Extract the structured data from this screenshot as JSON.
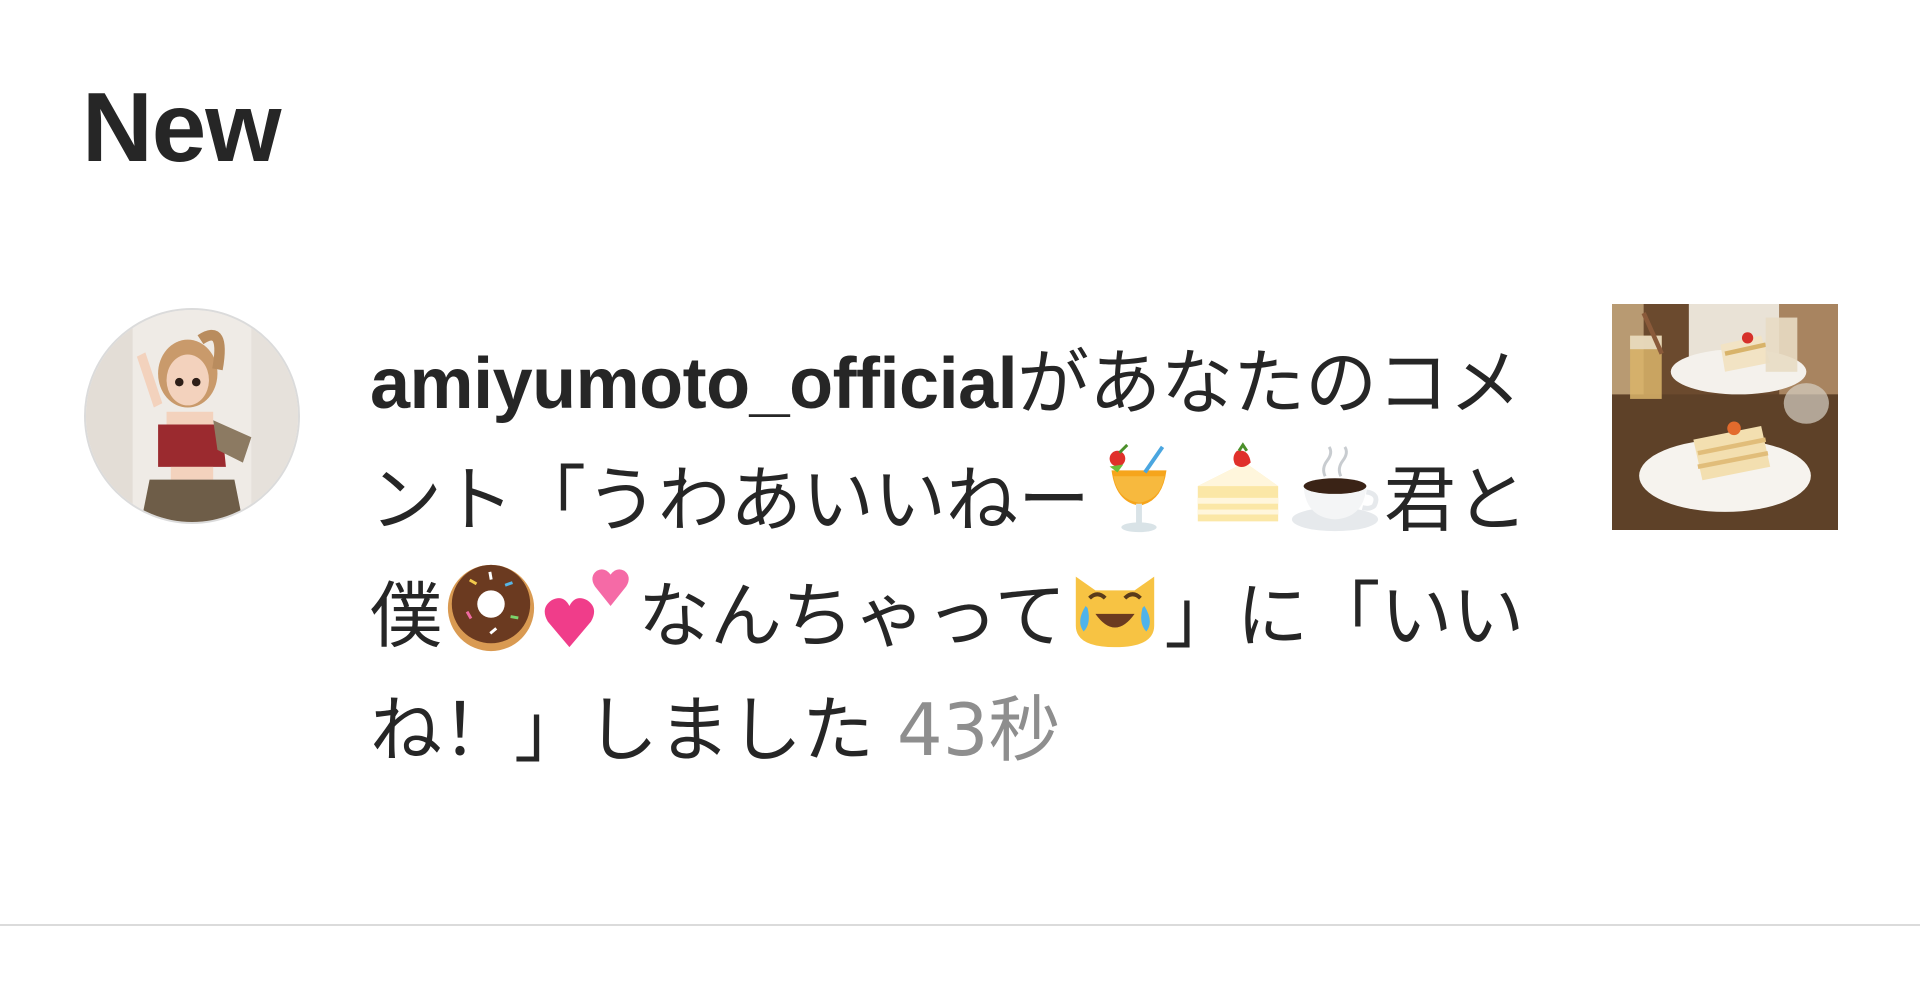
{
  "section": {
    "title": "New"
  },
  "notification": {
    "username": "amiyumoto_official",
    "text_parts": [
      "があなたのコメント「うわあいいねー",
      "君と僕",
      "なんちゃって",
      "」に「いいね！」しました"
    ],
    "timestamp": "43秒",
    "emojis": [
      "tropical-drink-emoji",
      "shortcake-emoji",
      "hot-beverage-emoji",
      "doughnut-emoji",
      "two-hearts-emoji",
      "cat-with-tears-of-joy-emoji"
    ]
  },
  "colors": {
    "text": "#262626",
    "timestamp": "#8e8e8e",
    "divider": "#dbdbdb",
    "background": "#ffffff"
  }
}
